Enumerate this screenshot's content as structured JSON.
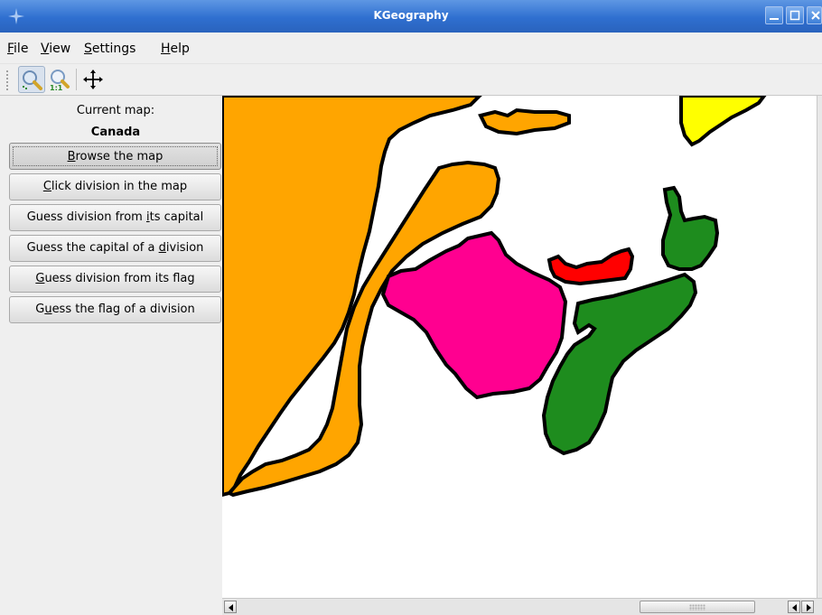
{
  "window": {
    "title": "KGeography"
  },
  "menubar": {
    "items": [
      {
        "label": "File",
        "mnemonic": "F",
        "rest": "ile"
      },
      {
        "label": "View",
        "mnemonic": "V",
        "rest": "iew"
      },
      {
        "label": "Settings",
        "mnemonic": "S",
        "rest": "ettings"
      },
      {
        "label": "Help",
        "mnemonic": "H",
        "rest": "elp"
      }
    ]
  },
  "toolbar": {
    "buttons": [
      {
        "icon": "zoom-icon",
        "active": true
      },
      {
        "icon": "original-size-icon",
        "active": false
      },
      {
        "icon": "move-icon",
        "active": false
      }
    ]
  },
  "sidebar": {
    "current_map_label": "Current map:",
    "current_map_name": "Canada",
    "buttons": [
      {
        "pre": "",
        "u": "B",
        "post": "rowse the map",
        "active": true
      },
      {
        "pre": "",
        "u": "C",
        "post": "lick division in the map",
        "active": false
      },
      {
        "pre": "Guess division from ",
        "u": "i",
        "post": "ts capital",
        "active": false
      },
      {
        "pre": "Guess the capital of a ",
        "u": "d",
        "post": "ivision",
        "active": false
      },
      {
        "pre": "",
        "u": "G",
        "post": "uess division from its flag",
        "active": false
      },
      {
        "pre": "G",
        "u": "u",
        "post": "ess the flag of a division",
        "active": false
      }
    ]
  },
  "map": {
    "colors": {
      "orange": "#ffa500",
      "magenta": "#ff0090",
      "red": "#ff0000",
      "green": "#1e8c1e",
      "yellow": "#ffff00",
      "outline": "#000000",
      "water": "#ffffff"
    }
  }
}
